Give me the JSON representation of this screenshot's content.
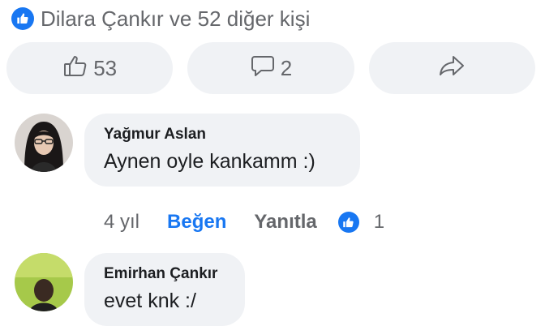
{
  "likes_summary": {
    "text": "Dilara Çankır ve 52 diğer kişi",
    "icon": "like-icon",
    "accent": "#1877f2"
  },
  "actions": {
    "like_count": "53",
    "comment_count": "2",
    "like_icon": "thumbs-up-icon",
    "comment_icon": "speech-bubble-icon",
    "share_icon": "share-arrow-icon"
  },
  "comments": [
    {
      "author": "Yağmur Aslan",
      "text": "Aynen oyle kankamm :)",
      "time": "4 yıl",
      "like_label": "Beğen",
      "reply_label": "Yanıtla",
      "reaction_count": "1"
    },
    {
      "author": "Emirhan Çankır",
      "text": "evet knk :/"
    }
  ]
}
